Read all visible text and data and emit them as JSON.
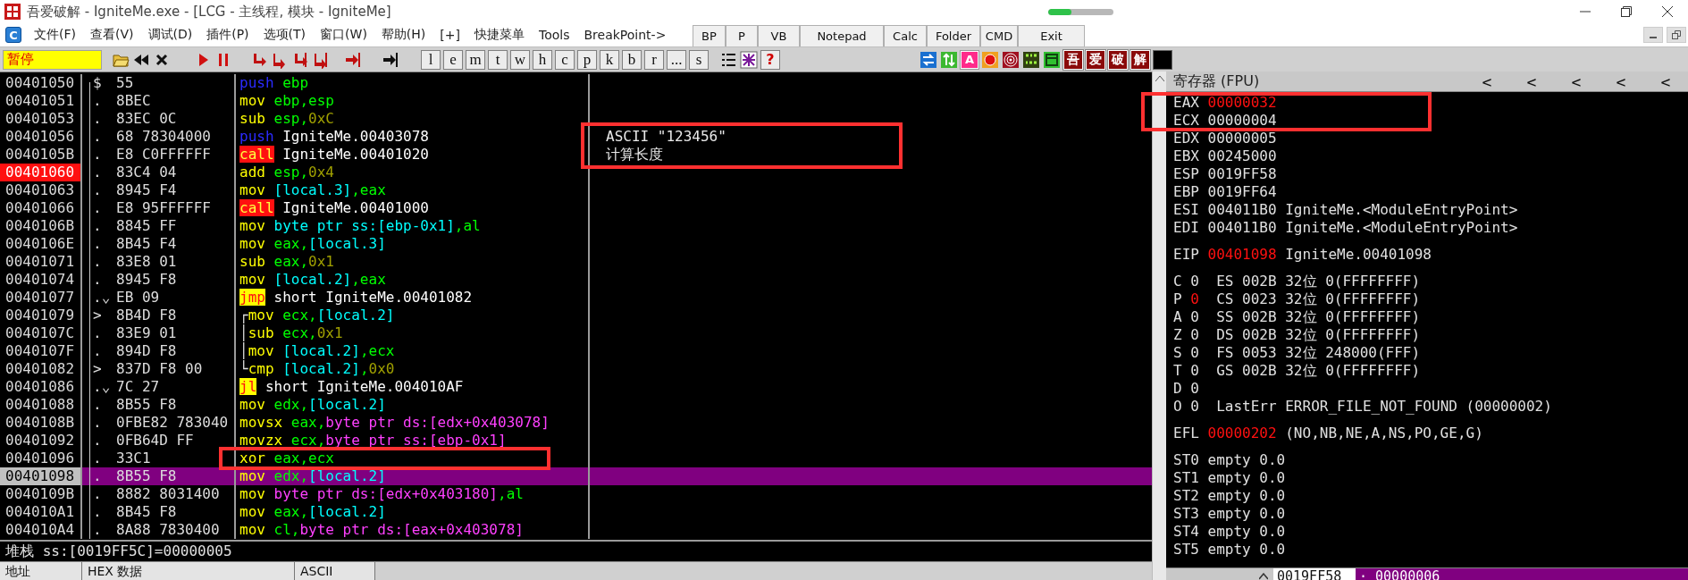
{
  "window": {
    "title": "吾爱破解 - IgniteMe.exe - [LCG -  主线程, 模块 - IgniteMe]",
    "progress": {
      "level": 0.35
    }
  },
  "menu": {
    "badge": "C",
    "items": [
      "文件(F)",
      "查看(V)",
      "调试(D)",
      "插件(P)",
      "选项(T)",
      "窗口(W)",
      "帮助(H)",
      "[+]",
      "快捷菜单",
      "Tools",
      "BreakPoint->"
    ]
  },
  "quick_buttons": [
    "BP",
    "P",
    "VB",
    "Notepad",
    "Calc",
    "Folder",
    "CMD",
    "Exit"
  ],
  "toolbar": {
    "status": "暂停",
    "letter_buttons": [
      "l",
      "e",
      "m",
      "t",
      "w",
      "h",
      "c",
      "p",
      "k",
      "b",
      "r",
      "...",
      "s"
    ],
    "help_button": "?",
    "letter_icon": "A",
    "brand_buttons": [
      "吾",
      "爱",
      "破",
      "解"
    ]
  },
  "disassembly": {
    "rows": [
      {
        "address": "00401050",
        "breakpoint": false,
        "current": false,
        "boxed": false,
        "marker": "$",
        "bytes": "55",
        "instruction": [
          {
            "text": "push",
            "kind": "push"
          },
          {
            "text": " ebp",
            "kind": "reg"
          }
        ]
      },
      {
        "address": "00401051",
        "breakpoint": false,
        "current": false,
        "boxed": false,
        "marker": ".",
        "bytes": "8BEC",
        "instruction": [
          {
            "text": "mov",
            "kind": "mnemonic"
          },
          {
            "text": " ebp,esp",
            "kind": "reg"
          }
        ]
      },
      {
        "address": "00401053",
        "breakpoint": false,
        "current": false,
        "boxed": false,
        "marker": ".",
        "bytes": "83EC 0C",
        "instruction": [
          {
            "text": "sub",
            "kind": "mnemonic"
          },
          {
            "text": " esp,",
            "kind": "reg"
          },
          {
            "text": "0xC",
            "kind": "imm"
          }
        ]
      },
      {
        "address": "00401056",
        "breakpoint": false,
        "current": false,
        "boxed": false,
        "marker": ".",
        "bytes": "68 78304000",
        "instruction": [
          {
            "text": "push",
            "kind": "push"
          },
          {
            "text": " IgniteMe.00403078",
            "kind": "label"
          }
        ],
        "comment": "ASCII \"123456\"",
        "comment_boxed": true
      },
      {
        "address": "0040105B",
        "breakpoint": false,
        "current": false,
        "boxed": false,
        "marker": ".",
        "bytes": "E8 C0FFFFFF",
        "instruction": [
          {
            "text": "call",
            "kind": "call"
          },
          {
            "text": " IgniteMe.00401020",
            "kind": "label"
          }
        ],
        "comment": "计算长度",
        "comment_boxed": true
      },
      {
        "address": "00401060",
        "breakpoint": true,
        "current": false,
        "boxed": false,
        "marker": ".",
        "bytes": "83C4 04",
        "instruction": [
          {
            "text": "add",
            "kind": "mnemonic"
          },
          {
            "text": " esp,",
            "kind": "reg"
          },
          {
            "text": "0x4",
            "kind": "imm"
          }
        ]
      },
      {
        "address": "00401063",
        "breakpoint": false,
        "current": false,
        "boxed": false,
        "marker": ".",
        "bytes": "8945 F4",
        "instruction": [
          {
            "text": "mov",
            "kind": "mnemonic"
          },
          {
            "text": " [local.3]",
            "kind": "mem"
          },
          {
            "text": ",eax",
            "kind": "reg"
          }
        ]
      },
      {
        "address": "00401066",
        "breakpoint": false,
        "current": false,
        "boxed": false,
        "marker": ".",
        "bytes": "E8 95FFFFFF",
        "instruction": [
          {
            "text": "call",
            "kind": "call"
          },
          {
            "text": " IgniteMe.00401000",
            "kind": "label"
          }
        ]
      },
      {
        "address": "0040106B",
        "breakpoint": false,
        "current": false,
        "boxed": false,
        "marker": ".",
        "bytes": "8845 FF",
        "instruction": [
          {
            "text": "mov",
            "kind": "mnemonic"
          },
          {
            "text": " byte ptr ss:[ebp-0x1]",
            "kind": "mem"
          },
          {
            "text": ",al",
            "kind": "reg"
          }
        ]
      },
      {
        "address": "0040106E",
        "breakpoint": false,
        "current": false,
        "boxed": false,
        "marker": ".",
        "bytes": "8B45 F4",
        "instruction": [
          {
            "text": "mov",
            "kind": "mnemonic"
          },
          {
            "text": " eax,",
            "kind": "reg"
          },
          {
            "text": "[local.3]",
            "kind": "mem"
          }
        ]
      },
      {
        "address": "00401071",
        "breakpoint": false,
        "current": false,
        "boxed": false,
        "marker": ".",
        "bytes": "83E8 01",
        "instruction": [
          {
            "text": "sub",
            "kind": "mnemonic"
          },
          {
            "text": " eax,",
            "kind": "reg"
          },
          {
            "text": "0x1",
            "kind": "imm"
          }
        ]
      },
      {
        "address": "00401074",
        "breakpoint": false,
        "current": false,
        "boxed": false,
        "marker": ".",
        "bytes": "8945 F8",
        "instruction": [
          {
            "text": "mov",
            "kind": "mnemonic"
          },
          {
            "text": " [local.2]",
            "kind": "mem"
          },
          {
            "text": ",eax",
            "kind": "reg"
          }
        ]
      },
      {
        "address": "00401077",
        "breakpoint": false,
        "current": false,
        "boxed": false,
        "marker": ".⌄",
        "bytes": "EB 09",
        "instruction": [
          {
            "text": "jmp",
            "kind": "jump"
          },
          {
            "text": " short IgniteMe.00401082",
            "kind": "label"
          }
        ]
      },
      {
        "address": "00401079",
        "breakpoint": false,
        "current": false,
        "boxed": false,
        "marker": ">",
        "bytes": "8B4D F8",
        "loop": "┌",
        "instruction": [
          {
            "text": "mov",
            "kind": "mnemonic"
          },
          {
            "text": " ecx,",
            "kind": "reg"
          },
          {
            "text": "[local.2]",
            "kind": "mem"
          }
        ]
      },
      {
        "address": "0040107C",
        "breakpoint": false,
        "current": false,
        "boxed": false,
        "marker": ".",
        "bytes": "83E9 01",
        "loop": "│",
        "instruction": [
          {
            "text": "sub",
            "kind": "mnemonic"
          },
          {
            "text": " ecx,",
            "kind": "reg"
          },
          {
            "text": "0x1",
            "kind": "imm"
          }
        ]
      },
      {
        "address": "0040107F",
        "breakpoint": false,
        "current": false,
        "boxed": false,
        "marker": ".",
        "bytes": "894D F8",
        "loop": "│",
        "instruction": [
          {
            "text": "mov",
            "kind": "mnemonic"
          },
          {
            "text": " [local.2]",
            "kind": "mem"
          },
          {
            "text": ",ecx",
            "kind": "reg"
          }
        ]
      },
      {
        "address": "00401082",
        "breakpoint": false,
        "current": false,
        "boxed": false,
        "marker": ">",
        "bytes": "837D F8 00",
        "loop": "└",
        "instruction": [
          {
            "text": "cmp",
            "kind": "mnemonic"
          },
          {
            "text": " [local.2]",
            "kind": "mem"
          },
          {
            "text": ",",
            "kind": "reg"
          },
          {
            "text": "0x0",
            "kind": "imm"
          }
        ]
      },
      {
        "address": "00401086",
        "breakpoint": false,
        "current": false,
        "boxed": false,
        "marker": ".⌄",
        "bytes": "7C 27",
        "instruction": [
          {
            "text": "jl",
            "kind": "jump"
          },
          {
            "text": " short IgniteMe.004010AF",
            "kind": "label"
          }
        ]
      },
      {
        "address": "00401088",
        "breakpoint": false,
        "current": false,
        "boxed": false,
        "marker": ".",
        "bytes": "8B55 F8",
        "instruction": [
          {
            "text": "mov",
            "kind": "mnemonic"
          },
          {
            "text": " edx,",
            "kind": "reg"
          },
          {
            "text": "[local.2]",
            "kind": "mem"
          }
        ]
      },
      {
        "address": "0040108B",
        "breakpoint": false,
        "current": false,
        "boxed": false,
        "marker": ".",
        "bytes": "0FBE82 783040",
        "instruction": [
          {
            "text": "movsx",
            "kind": "mnemonic"
          },
          {
            "text": " eax,",
            "kind": "reg"
          },
          {
            "text": "byte ptr ds:[edx+0x403078]",
            "kind": "ptr"
          }
        ]
      },
      {
        "address": "00401092",
        "breakpoint": false,
        "current": false,
        "boxed": false,
        "marker": ".",
        "bytes": "0FB64D FF",
        "instruction": [
          {
            "text": "movzx",
            "kind": "mnemonic"
          },
          {
            "text": " ecx,",
            "kind": "reg"
          },
          {
            "text": "byte ptr ss:[ebp-0x1]",
            "kind": "ptr"
          }
        ]
      },
      {
        "address": "00401096",
        "breakpoint": false,
        "current": false,
        "boxed": true,
        "marker": ".",
        "bytes": "33C1",
        "instruction": [
          {
            "text": "xor",
            "kind": "mnemonic"
          },
          {
            "text": " eax,ecx",
            "kind": "reg"
          }
        ]
      },
      {
        "address": "00401098",
        "breakpoint": false,
        "current": true,
        "boxed": false,
        "marker": ".",
        "bytes": "8B55 F8",
        "instruction": [
          {
            "text": "mov",
            "kind": "mnemonic"
          },
          {
            "text": " edx,",
            "kind": "reg"
          },
          {
            "text": "[local.2]",
            "kind": "mem"
          }
        ]
      },
      {
        "address": "0040109B",
        "breakpoint": false,
        "current": false,
        "boxed": false,
        "marker": ".",
        "bytes": "8882 8031400",
        "instruction": [
          {
            "text": "mov",
            "kind": "mnemonic"
          },
          {
            "text": " byte ptr ds:[edx+0x403180]",
            "kind": "ptr"
          },
          {
            "text": ",al",
            "kind": "reg"
          }
        ]
      },
      {
        "address": "004010A1",
        "breakpoint": false,
        "current": false,
        "boxed": false,
        "marker": ".",
        "bytes": "8B45 F8",
        "instruction": [
          {
            "text": "mov",
            "kind": "mnemonic"
          },
          {
            "text": " eax,",
            "kind": "reg"
          },
          {
            "text": "[local.2]",
            "kind": "mem"
          }
        ]
      },
      {
        "address": "004010A4",
        "breakpoint": false,
        "current": false,
        "boxed": false,
        "marker": ".",
        "bytes": "8A88 7830400",
        "instruction": [
          {
            "text": "mov",
            "kind": "mnemonic"
          },
          {
            "text": " cl,",
            "kind": "reg"
          },
          {
            "text": "byte ptr ds:[eax+0x403078]",
            "kind": "ptr"
          }
        ]
      }
    ]
  },
  "stack_line": "堆栈 ss:[0019FF5C]=00000005",
  "dump_columns": [
    "地址",
    "HEX 数据",
    "ASCII"
  ],
  "registers": {
    "title": "寄存器 (FPU)",
    "column_buttons": [
      "<",
      "<",
      "<",
      "<",
      "<"
    ],
    "groups": [
      {
        "lines": [
          {
            "name": "EAX",
            "value": "00000032",
            "changed": true,
            "boxed": true
          },
          {
            "name": "ECX",
            "value": "00000004",
            "changed": false,
            "boxed": true
          },
          {
            "name": "EDX",
            "value": "00000005",
            "changed": false,
            "boxed": false
          },
          {
            "name": "EBX",
            "value": "00245000",
            "changed": false,
            "boxed": false
          },
          {
            "name": "ESP",
            "value": "0019FF58",
            "changed": false,
            "boxed": false
          },
          {
            "name": "EBP",
            "value": "0019FF64",
            "changed": false,
            "boxed": false
          },
          {
            "name": "ESI",
            "value": "004011B0",
            "changed": false,
            "boxed": false,
            "detail": "IgniteMe.<ModuleEntryPoint>"
          },
          {
            "name": "EDI",
            "value": "004011B0",
            "changed": false,
            "boxed": false,
            "detail": "IgniteMe.<ModuleEntryPoint>"
          }
        ]
      },
      {
        "lines": [
          {
            "name": "EIP",
            "value": "00401098",
            "changed": true,
            "detail": "IgniteMe.00401098"
          }
        ]
      },
      {
        "lines": [
          {
            "name": "C",
            "value": "0",
            "changed": false,
            "detail": " ES 002B 32位 0(FFFFFFFF)"
          },
          {
            "name": "P",
            "value": "0",
            "changed": true,
            "detail": " CS 0023 32位 0(FFFFFFFF)"
          },
          {
            "name": "A",
            "value": "0",
            "changed": false,
            "detail": " SS 002B 32位 0(FFFFFFFF)"
          },
          {
            "name": "Z",
            "value": "0",
            "changed": false,
            "detail": " DS 002B 32位 0(FFFFFFFF)"
          },
          {
            "name": "S",
            "value": "0",
            "changed": false,
            "detail": " FS 0053 32位 248000(FFF)"
          },
          {
            "name": "T",
            "value": "0",
            "changed": false,
            "detail": " GS 002B 32位 0(FFFFFFFF)"
          },
          {
            "name": "D",
            "value": "0",
            "changed": false
          },
          {
            "name": "O",
            "value": "0",
            "changed": false,
            "detail": " LastErr ERROR_FILE_NOT_FOUND (00000002)"
          }
        ]
      },
      {
        "lines": [
          {
            "name": "EFL",
            "value": "00000202",
            "changed": true,
            "detail": "(NO,NB,NE,A,NS,PO,GE,G)"
          }
        ]
      },
      {
        "lines": [
          {
            "name": "ST0",
            "value": "empty 0.0",
            "changed": false
          },
          {
            "name": "ST1",
            "value": "empty 0.0",
            "changed": false
          },
          {
            "name": "ST2",
            "value": "empty 0.0",
            "changed": false
          },
          {
            "name": "ST3",
            "value": "empty 0.0",
            "changed": false
          },
          {
            "name": "ST4",
            "value": "empty 0.0",
            "changed": false
          },
          {
            "name": "ST5",
            "value": "empty 0.0",
            "changed": false
          }
        ]
      }
    ]
  },
  "stack_pane": {
    "address": "0019FF58",
    "value": "· 00000006"
  }
}
